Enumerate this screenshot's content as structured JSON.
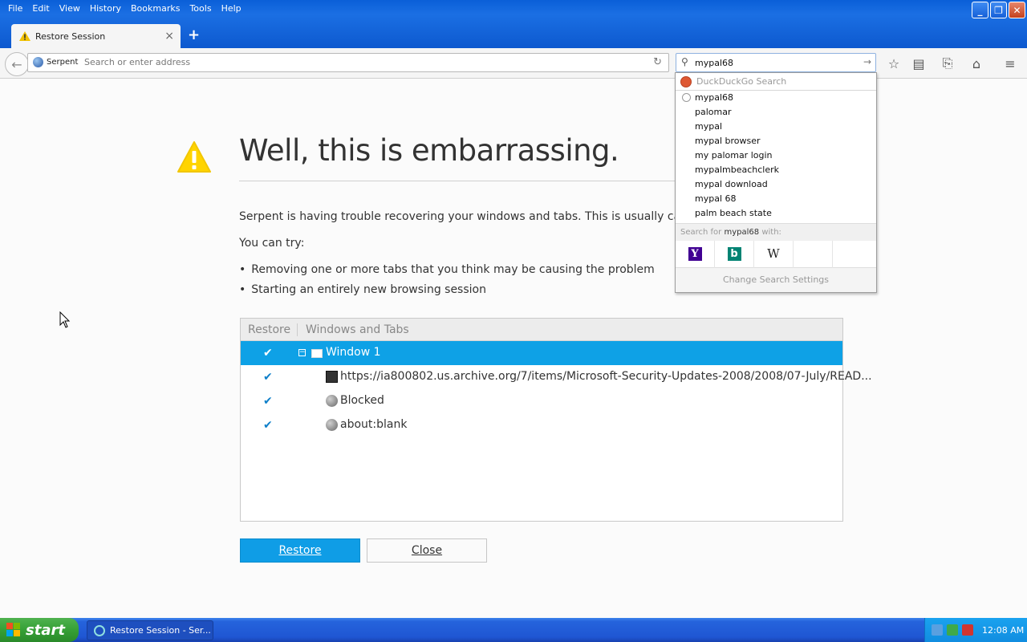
{
  "menubar": [
    "File",
    "Edit",
    "View",
    "History",
    "Bookmarks",
    "Tools",
    "Help"
  ],
  "tab": {
    "label": "Restore Session"
  },
  "toolbar": {
    "identity": "Serpent",
    "url_placeholder": "Search or enter address",
    "search_value": "mypal68"
  },
  "page": {
    "title": "Well, this is embarrassing.",
    "message": "Serpent is having trouble recovering your windows and tabs. This is usually caused",
    "you_can_try": "You can try:",
    "bullets": [
      "Removing one or more tabs that you think may be causing the problem",
      "Starting an entirely new browsing session"
    ],
    "tree_headers": {
      "restore": "Restore",
      "windows_tabs": "Windows and Tabs"
    },
    "rows": [
      "Window 1",
      "https://ia800802.us.archive.org/7/items/Microsoft-Security-Updates-2008/2008/07-July/READ...",
      "Blocked",
      "about:blank"
    ],
    "restore_button": "Restore",
    "close_button": "Close"
  },
  "search_popup": {
    "engine": "DuckDuckGo Search",
    "suggestions": [
      "mypal68",
      "palomar",
      "mypal",
      "mypal browser",
      "my palomar login",
      "mypalmbeachclerk",
      "mypal download",
      "mypal 68",
      "palm beach state"
    ],
    "search_for_prefix": "Search for",
    "search_for_term": "mypal68",
    "search_for_suffix": "with:",
    "engines": [
      "Y",
      "b",
      "W"
    ],
    "settings": "Change Search Settings"
  },
  "taskbar": {
    "start": "start",
    "task": "Restore Session - Ser...",
    "clock": "12:08 AM"
  },
  "colors": {
    "accent": "#0ea1e6",
    "warning": "#ffd400",
    "titlebar": "#0d59cf"
  }
}
